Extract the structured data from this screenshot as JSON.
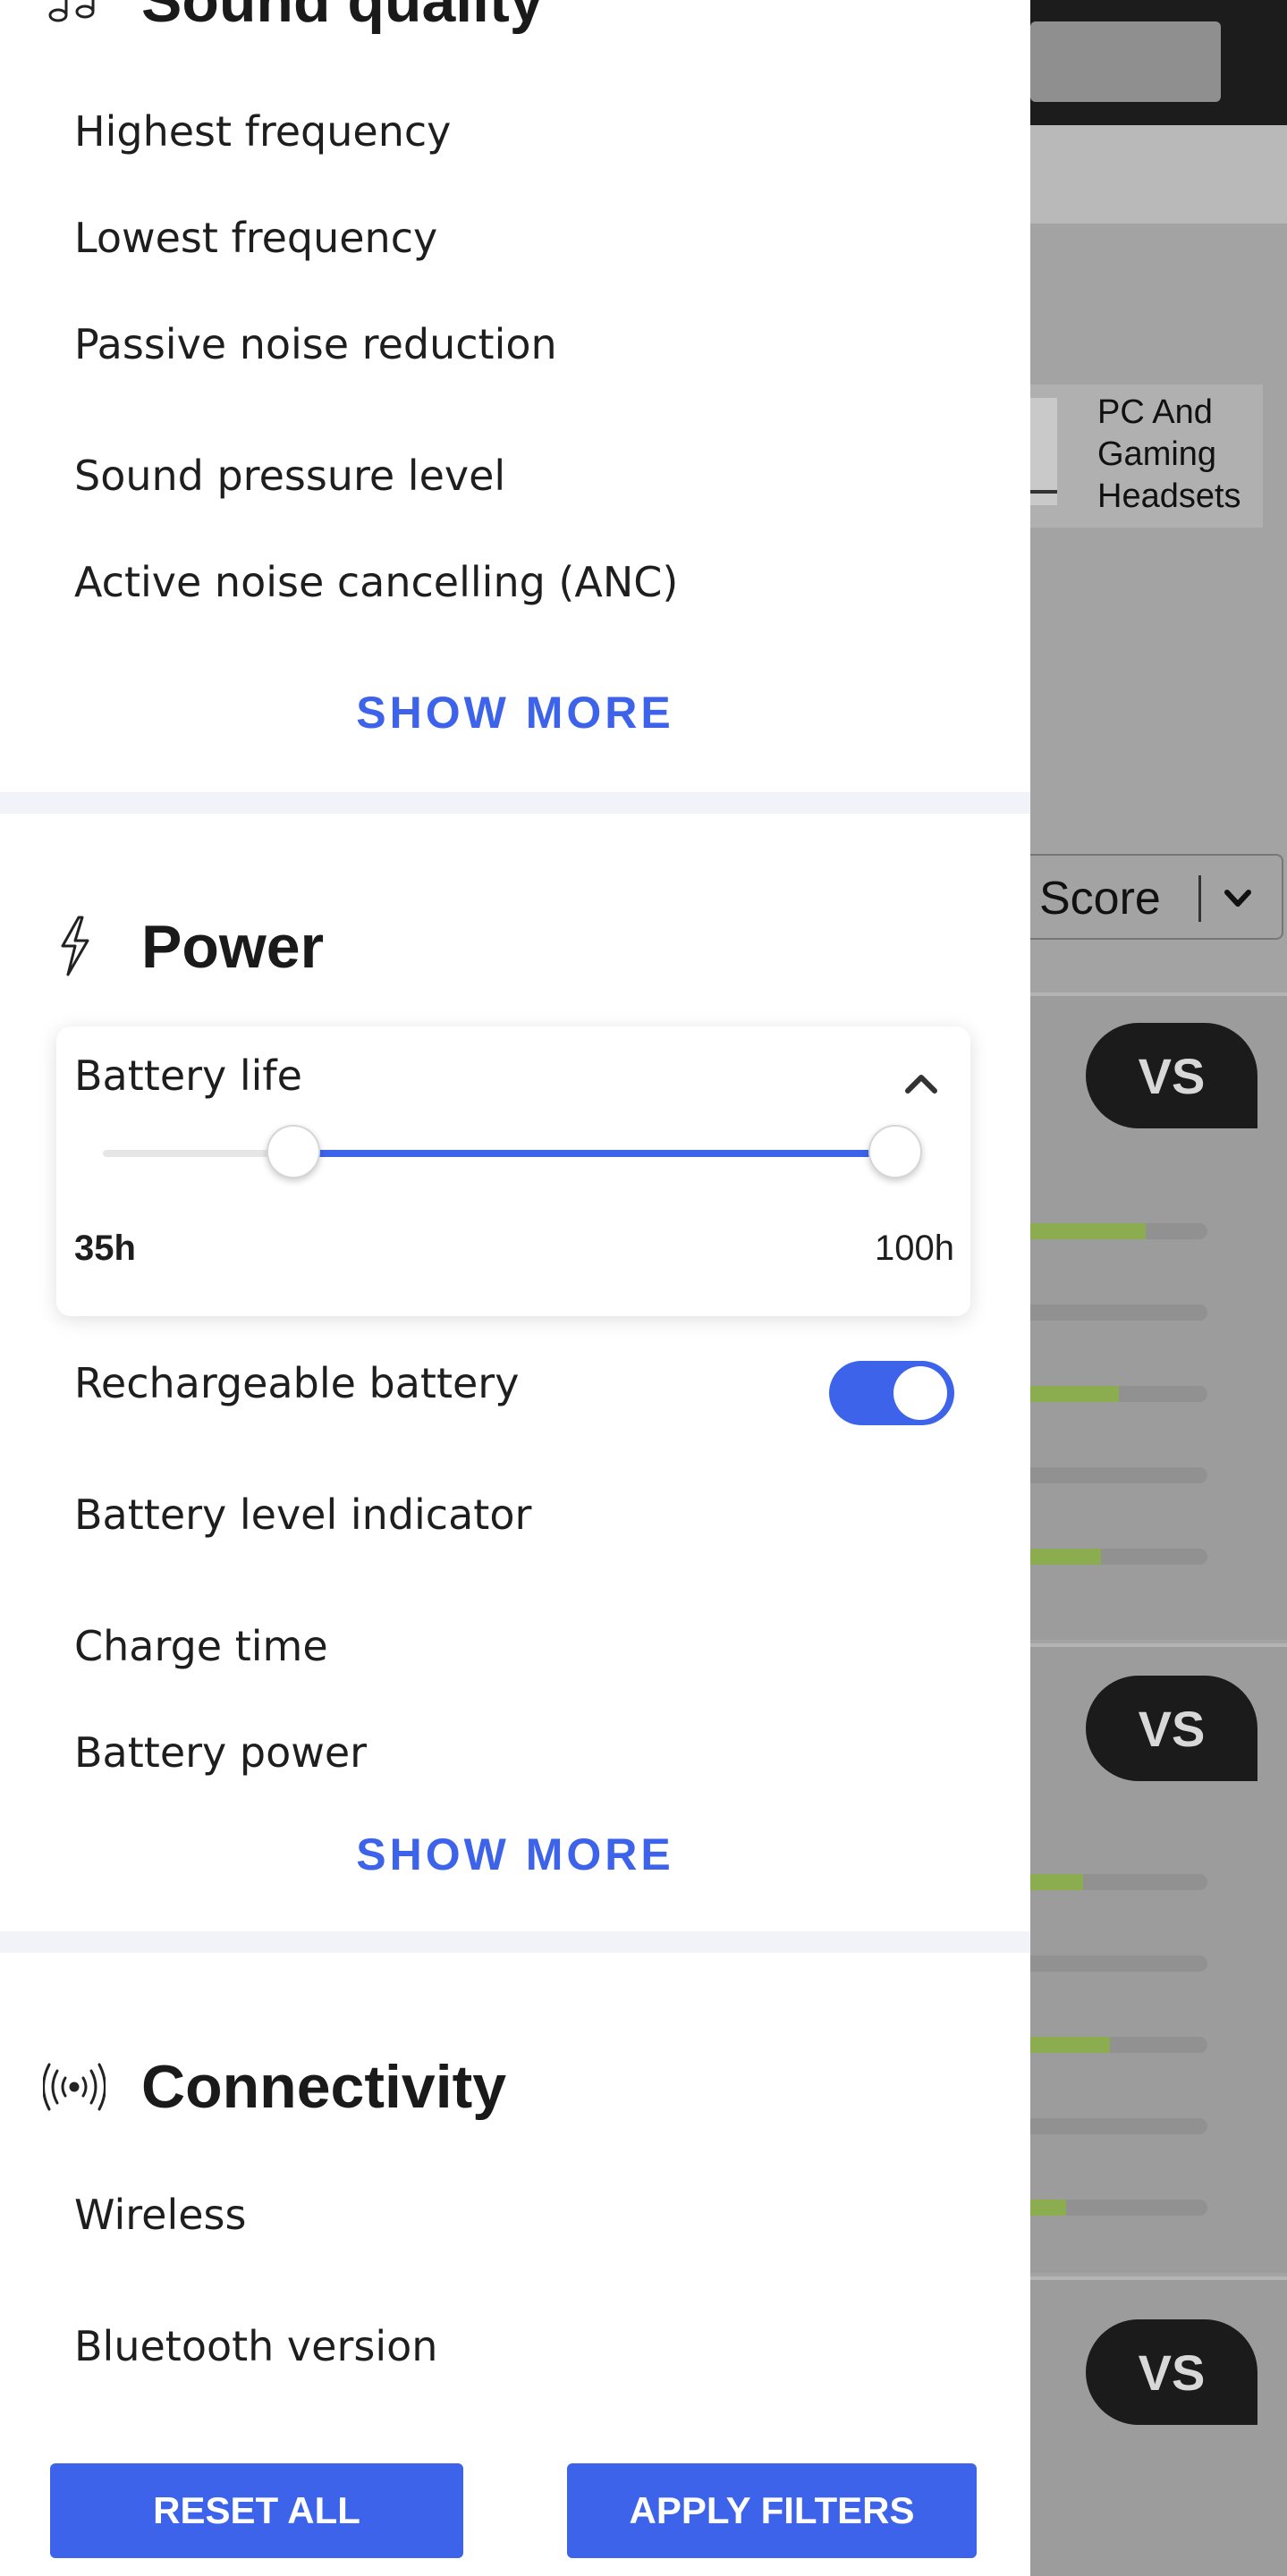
{
  "background": {
    "category_label": "PC And Gaming Headsets",
    "sort_label": "Score",
    "vs_badge": "VS",
    "cards": [
      {
        "bars": [
          0.65,
          0,
          0.5,
          0,
          0.4
        ]
      },
      {
        "bars": [
          0.3,
          0,
          0.45,
          0,
          0.2
        ]
      }
    ]
  },
  "filters": {
    "sound_quality": {
      "title": "Sound quality",
      "icon": "music-notes-icon",
      "items": [
        "Highest frequency",
        "Lowest frequency",
        "Passive noise reduction",
        "Sound pressure level",
        "Active noise cancelling (ANC)"
      ],
      "show_more": "SHOW MORE"
    },
    "power": {
      "title": "Power",
      "icon": "lightning-icon",
      "battery_life": {
        "label": "Battery life",
        "min_label": "35h",
        "max_label": "100h",
        "range_start_fraction": 0.24,
        "range_end_fraction": 1.0
      },
      "rechargeable_battery": {
        "label": "Rechargeable battery",
        "enabled": true
      },
      "items": [
        "Battery level indicator",
        "Charge time",
        "Battery power"
      ],
      "show_more": "SHOW MORE"
    },
    "connectivity": {
      "title": "Connectivity",
      "icon": "wireless-signal-icon",
      "items": [
        "Wireless",
        "Bluetooth version"
      ]
    }
  },
  "footer": {
    "reset_label": "RESET ALL",
    "apply_label": "APPLY FILTERS"
  },
  "colors": {
    "accent": "#3d63ea",
    "score_bar": "#8bac4f"
  }
}
